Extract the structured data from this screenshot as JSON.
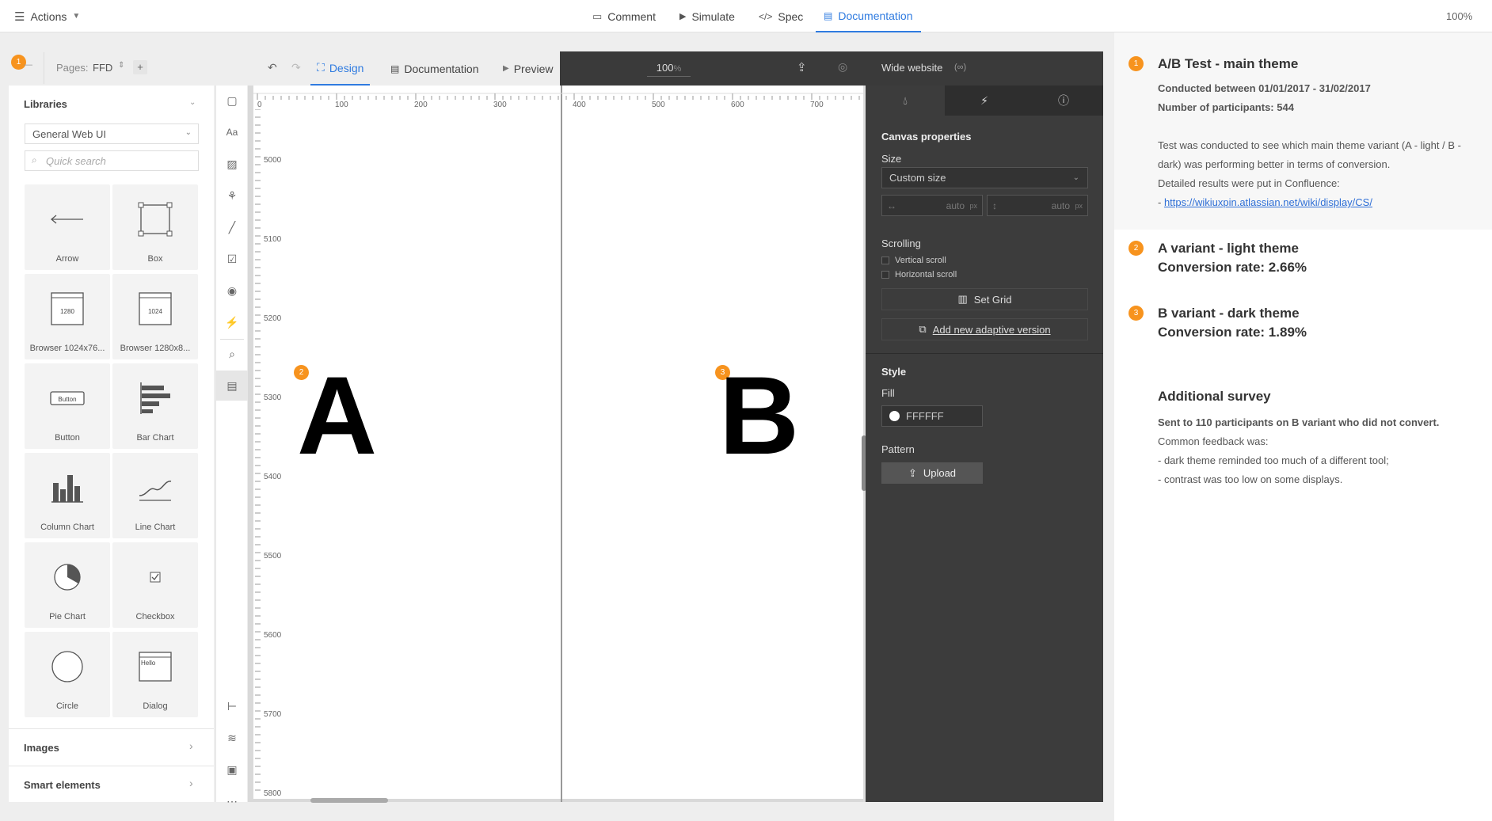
{
  "topbar": {
    "actions_label": "Actions",
    "tabs": [
      {
        "label": "Comment",
        "icon": "comment-icon"
      },
      {
        "label": "Simulate",
        "icon": "play-icon"
      },
      {
        "label": "Spec",
        "icon": "code-icon"
      },
      {
        "label": "Documentation",
        "icon": "document-icon",
        "active": true
      }
    ],
    "zoom": "100%"
  },
  "pages_bar": {
    "badge": "1",
    "pages_label": "Pages:",
    "page_name": "FFD",
    "add": "+"
  },
  "editor_toolbar": {
    "tabs": [
      "Design",
      "Documentation",
      "Preview"
    ],
    "active_tab": "Design",
    "zoom_value": "100",
    "zoom_unit": "%"
  },
  "libraries": {
    "title": "Libraries",
    "selected_library": "General Web UI",
    "search_placeholder": "Quick search",
    "items": [
      {
        "label": "Arrow",
        "icon": "arrow-icon"
      },
      {
        "label": "Box",
        "icon": "box-icon"
      },
      {
        "label": "Browser 1024x76...",
        "icon": "browser-icon",
        "badge": "1280"
      },
      {
        "label": "Browser 1280x8...",
        "icon": "browser-icon",
        "badge": "1024"
      },
      {
        "label": "Button",
        "icon": "button-icon",
        "badge": "Button"
      },
      {
        "label": "Bar Chart",
        "icon": "bar-chart-icon"
      },
      {
        "label": "Column Chart",
        "icon": "column-chart-icon"
      },
      {
        "label": "Line Chart",
        "icon": "line-chart-icon"
      },
      {
        "label": "Pie Chart",
        "icon": "pie-chart-icon"
      },
      {
        "label": "Checkbox",
        "icon": "checkbox-icon"
      },
      {
        "label": "Circle",
        "icon": "circle-icon"
      },
      {
        "label": "Dialog",
        "icon": "dialog-icon",
        "badge": "Hello"
      }
    ],
    "sections": [
      "Images",
      "Smart elements"
    ]
  },
  "canvas": {
    "h_ticks": [
      "0",
      "100",
      "200",
      "300",
      "400",
      "500",
      "600",
      "700"
    ],
    "v_ticks": [
      "5000",
      "5100",
      "5200",
      "5300",
      "5400",
      "5500",
      "5600",
      "5700",
      "5800"
    ],
    "letter_a": "A",
    "letter_b": "B",
    "badge_a": "2",
    "badge_b": "3"
  },
  "properties": {
    "title": "Wide website",
    "title_suffix": "(∞)",
    "section_canvas": "Canvas properties",
    "size_label": "Size",
    "size_value": "Custom size",
    "width_value": "auto",
    "height_value": "auto",
    "unit": "px",
    "scrolling_label": "Scrolling",
    "vertical_scroll": "Vertical scroll",
    "horizontal_scroll": "Horizontal scroll",
    "set_grid": "Set Grid",
    "add_adaptive": "Add new adaptive version",
    "style_label": "Style",
    "fill_label": "Fill",
    "fill_value": "FFFFFF",
    "pattern_label": "Pattern",
    "upload": "Upload"
  },
  "documentation": {
    "sections": [
      {
        "badge": "1",
        "title": "A/B Test - main theme",
        "meta1": "Conducted between 01/01/2017 - 31/02/2017",
        "meta2": "Number of participants: 544",
        "body1": "Test was conducted to see which main theme variant (A - light / B -",
        "body2": "dark) was performing better in terms of conversion.",
        "body3": "Detailed results were put in Confluence:",
        "link_prefix": "- ",
        "link": "https://wikiuxpin.atlassian.net/wiki/display/CS/"
      },
      {
        "badge": "2",
        "title": "A variant - light theme",
        "subtitle": "Conversion rate: 2.66%"
      },
      {
        "badge": "3",
        "title": "B variant - dark theme",
        "subtitle": "Conversion rate: 1.89%"
      }
    ],
    "survey": {
      "title": "Additional survey",
      "line1": "Sent to 110 participants on B variant who did not convert.",
      "line2": "Common feedback was:",
      "line3": "- dark theme reminded too much of a different tool;",
      "line4": "- contrast was too low on some displays."
    }
  },
  "colors": {
    "accent": "#2f7be0",
    "badge": "#f7931e",
    "dark_panel": "#3c3c3c"
  }
}
